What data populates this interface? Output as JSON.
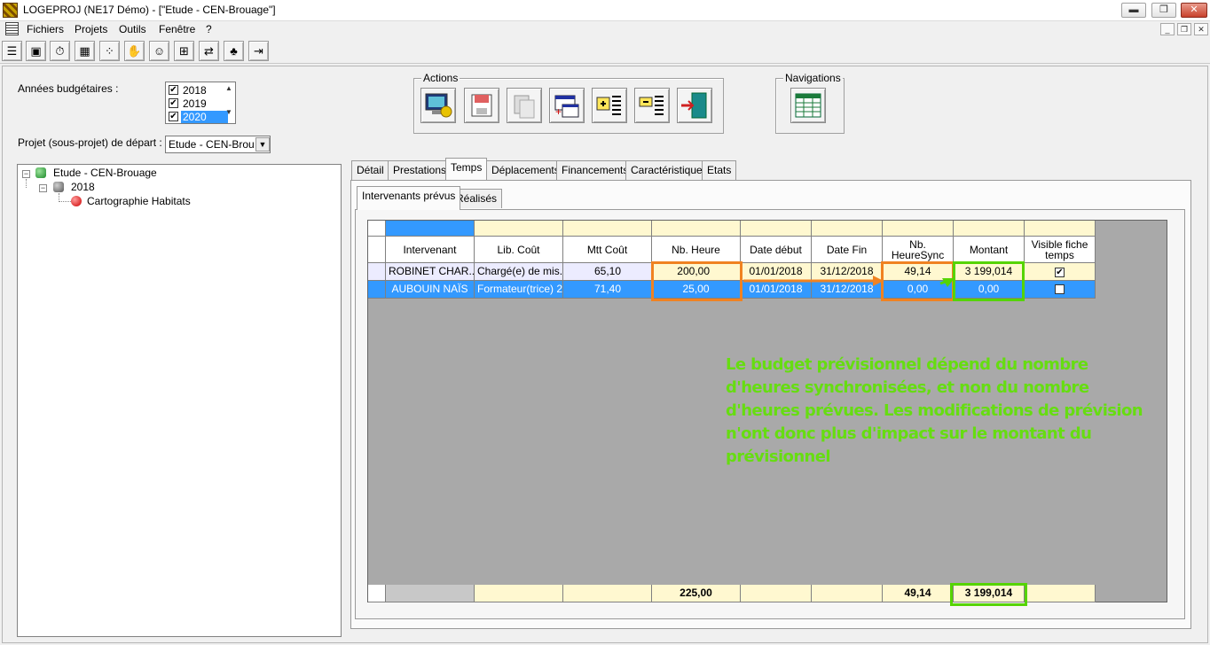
{
  "window": {
    "title": "LOGEPROJ (NE17 Démo) - [\"Etude - CEN-Brouage\"]",
    "minimize": "▬",
    "restore": "❐",
    "close": "✕"
  },
  "menu": {
    "items": [
      "Fichiers",
      "Projets",
      "Outils",
      "Fenêtre",
      "?"
    ],
    "mdi_minimize": "_",
    "mdi_restore": "❐",
    "mdi_close": "✕"
  },
  "toolbar": {
    "buttons": [
      {
        "icon": "list-icon",
        "glyph": "☰"
      },
      {
        "icon": "scanner-icon",
        "glyph": "▣"
      },
      {
        "icon": "stopwatch-icon",
        "glyph": "⏱"
      },
      {
        "icon": "calculator-icon",
        "glyph": "▦"
      },
      {
        "icon": "network-icon",
        "glyph": "⁘"
      },
      {
        "icon": "handshake-icon",
        "glyph": "✋"
      },
      {
        "icon": "people-icon",
        "glyph": "☺"
      },
      {
        "icon": "tree-chart-icon",
        "glyph": "⊞"
      },
      {
        "icon": "split-icon",
        "glyph": "⇄"
      },
      {
        "icon": "frog-icon",
        "glyph": "♣"
      },
      {
        "icon": "exit-icon",
        "glyph": "⇥"
      }
    ]
  },
  "filters": {
    "years_label": "Années budgétaires :",
    "years": [
      {
        "label": "2018",
        "checked": true,
        "selected": false
      },
      {
        "label": "2019",
        "checked": true,
        "selected": false
      },
      {
        "label": "2020",
        "checked": true,
        "selected": true
      }
    ],
    "project_label": "Projet (sous-projet) de départ :",
    "project_value": "Etude - CEN-Brouage"
  },
  "tree": {
    "root": "Etude - CEN-Brouage",
    "year": "2018",
    "leaf": "Cartographie Habitats"
  },
  "actions": {
    "title": "Actions",
    "buttons": [
      "computer-settings-icon",
      "save-disk-icon",
      "copy-icon",
      "window-add-icon",
      "add-row-icon",
      "remove-row-icon",
      "exit-door-icon"
    ]
  },
  "navigations": {
    "title": "Navigations",
    "button": "table-grid-icon"
  },
  "tabs": [
    "Détail",
    "Prestations",
    "Temps",
    "Déplacements",
    "Financements",
    "Caractéristiques",
    "Etats"
  ],
  "active_tab": "Temps",
  "subtabs": [
    "Intervenants prévus",
    "Réalisés"
  ],
  "grid": {
    "headers": [
      "Intervenant",
      "Lib. Coût",
      "Mtt Coût",
      "Nb. Heure",
      "Date début",
      "Date Fin",
      "Nb. HeureSync",
      "Montant",
      "Visible fiche temps"
    ],
    "rows": [
      {
        "intervenant": "ROBINET CHAR...",
        "lib_cout": "Chargé(e) de mis...",
        "mtt_cout": "65,10",
        "nb_heure": "200,00",
        "date_debut": "01/01/2018",
        "date_fin": "31/12/2018",
        "nb_heuresync": "49,14",
        "montant": "3 199,014",
        "visible": true
      },
      {
        "intervenant": "AUBOUIN NAÏS",
        "lib_cout": "Formateur(trice) 2...",
        "mtt_cout": "71,40",
        "nb_heure": "25,00",
        "date_debut": "01/01/2018",
        "date_fin": "31/12/2018",
        "nb_heuresync": "0,00",
        "montant": "0,00",
        "visible": false
      }
    ],
    "totals": {
      "nb_heure": "225,00",
      "nb_heuresync": "49,14",
      "montant": "3 199,014"
    }
  },
  "annotation": {
    "lines": [
      "Le budget prévisionnel dépend du nombre",
      "d'heures synchronisées, et non du nombre",
      "d'heures prévues. Les modifications de prévision",
      "n'ont donc plus d'impact sur le montant du",
      "prévisionnel"
    ],
    "highlight_orange": "#f08221",
    "highlight_green": "#55d400"
  }
}
